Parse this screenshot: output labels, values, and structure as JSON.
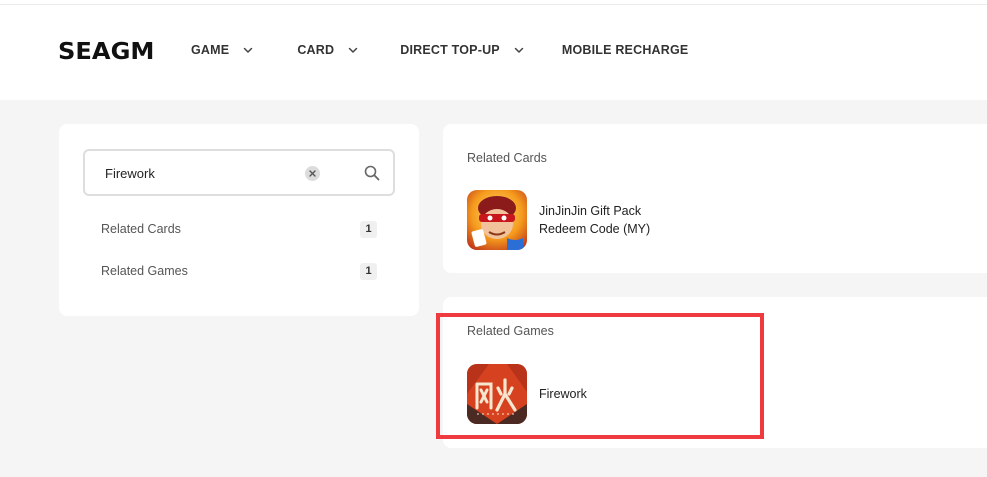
{
  "brand": {
    "logo": "SEAGM"
  },
  "nav": {
    "items": [
      {
        "label": "GAME",
        "dropdown": true
      },
      {
        "label": "CARD",
        "dropdown": true
      },
      {
        "label": "DIRECT TOP-UP",
        "dropdown": true
      },
      {
        "label": "MOBILE RECHARGE",
        "dropdown": false
      }
    ]
  },
  "search": {
    "value": "Firework"
  },
  "filters": [
    {
      "label": "Related Cards",
      "count": "1"
    },
    {
      "label": "Related Games",
      "count": "1"
    }
  ],
  "related_cards": {
    "title": "Related Cards",
    "items": [
      {
        "name": "JinJinJin Gift Pack Redeem Code (MY)"
      }
    ]
  },
  "related_games": {
    "title": "Related Games",
    "items": [
      {
        "name": "Firework"
      }
    ]
  },
  "colors": {
    "highlight": "#ef3a3f",
    "page_bg": "#f5f5f5"
  }
}
